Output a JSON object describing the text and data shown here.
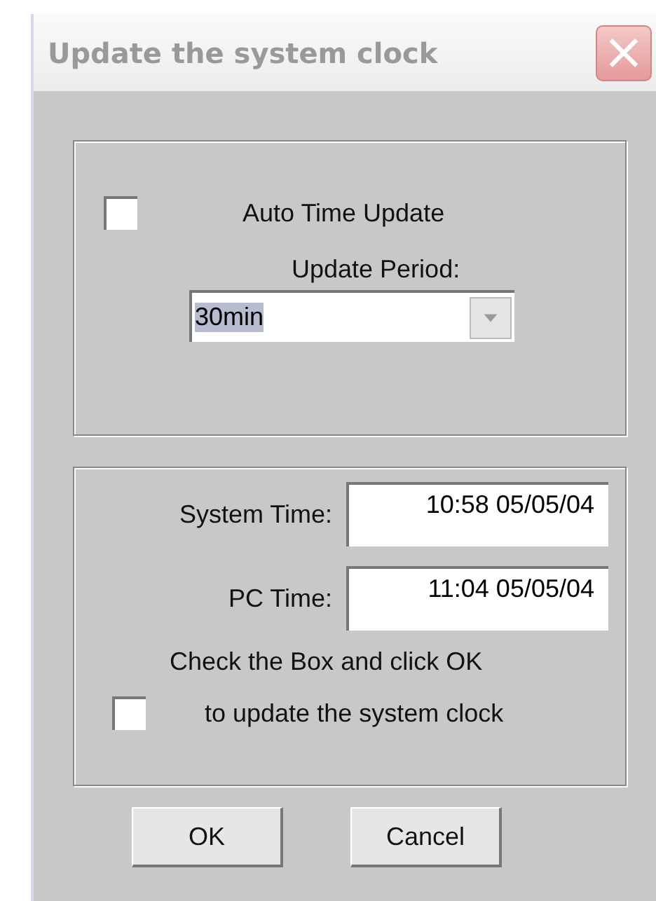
{
  "window": {
    "title": "Update the system clock",
    "close": "×"
  },
  "auto_update": {
    "label": "Auto Time Update",
    "checked": false
  },
  "update_period": {
    "label": "Update Period:",
    "value": "30min",
    "highlighted": true
  },
  "times": [
    {
      "label": "System Time:",
      "value": "10:58 05/05/04"
    },
    {
      "label": "PC Time:",
      "value": "11:04 05/05/04"
    }
  ],
  "instruction": "Check the Box and click OK",
  "update_clock": {
    "label": "to update the system clock",
    "checked": false
  },
  "buttons": [
    "OK",
    "Cancel"
  ]
}
